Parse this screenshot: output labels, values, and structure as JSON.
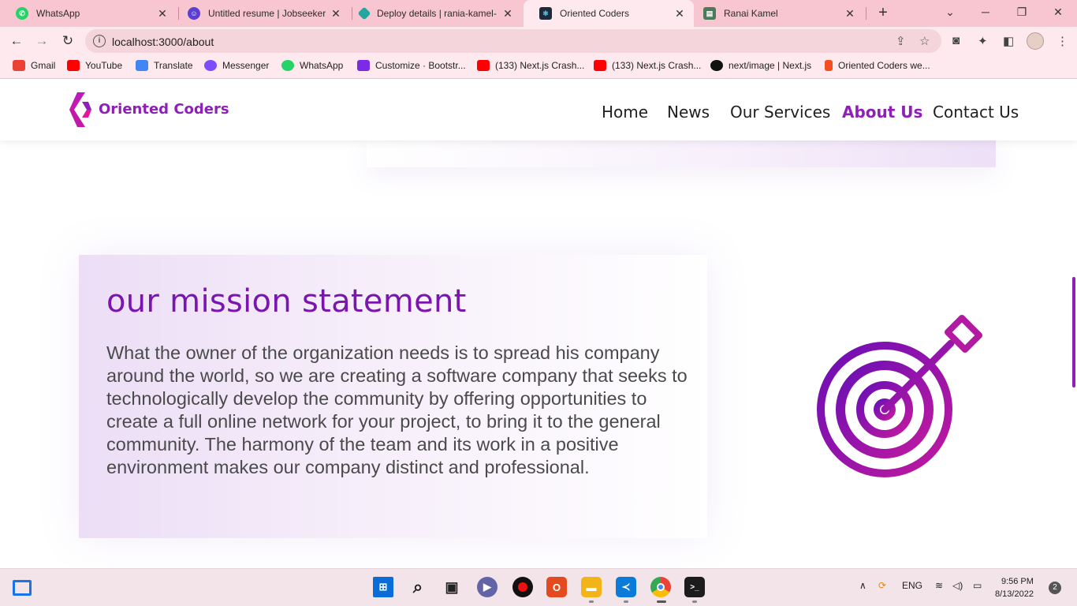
{
  "browser": {
    "tabs": [
      {
        "title": "WhatsApp",
        "icon": "whatsapp-icon",
        "color": "#25d366"
      },
      {
        "title": "Untitled resume | Jobseeker",
        "icon": "jobseeker-icon",
        "color": "#5b3fd1"
      },
      {
        "title": "Deploy details | rania-kamel-",
        "icon": "netlify-icon",
        "color": "#20a7a0"
      },
      {
        "title": "Oriented Coders",
        "icon": "react-icon",
        "color": "#1e2a3a"
      },
      {
        "title": "Ranai Kamel",
        "icon": "site-icon",
        "color": "#4a7a5a"
      }
    ],
    "url": "localhost:3000/about",
    "bookmarks": [
      {
        "label": "Gmail",
        "color": "#ea4335"
      },
      {
        "label": "YouTube",
        "color": "#ff0000"
      },
      {
        "label": "Translate",
        "color": "#4285f4"
      },
      {
        "label": "Messenger",
        "color": "#7b4dff"
      },
      {
        "label": "WhatsApp",
        "color": "#25d366"
      },
      {
        "label": "Customize · Bootstr...",
        "color": "#7c2ae8"
      },
      {
        "label": "(133) Next.js Crash...",
        "color": "#ff0000"
      },
      {
        "label": "(133) Next.js Crash...",
        "color": "#ff0000"
      },
      {
        "label": "next/image | Next.js",
        "color": "#111111"
      },
      {
        "label": "Oriented Coders we...",
        "color": "#f24e1e"
      }
    ]
  },
  "site": {
    "brand": "Oriented Coders",
    "nav": [
      "Home",
      "News",
      "Our Services",
      "About Us",
      "Contact Us"
    ],
    "active_nav": "About Us",
    "accent": "#8e1fb7"
  },
  "mission": {
    "title": "our mission statement",
    "text": "What the owner of the organization needs is to spread his company around the world, so we are creating a software company that seeks to technologically develop the community by offering opportunities to create a full online network for your project, to bring it to the general community. The harmony of the team and its work in a positive environment makes our company distinct and professional.",
    "icon": "target-icon"
  },
  "taskbar": {
    "language": "ENG",
    "time": "9:56 PM",
    "date": "8/13/2022",
    "notifications": "2"
  }
}
